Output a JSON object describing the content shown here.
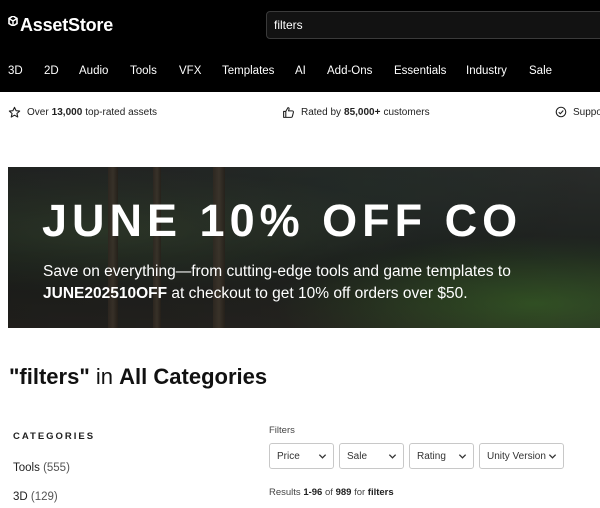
{
  "header": {
    "logo_text": "AssetStore",
    "search_value": "filters",
    "nav": [
      "3D",
      "2D",
      "Audio",
      "Tools",
      "VFX",
      "Templates",
      "AI",
      "Add-Ons",
      "Essentials",
      "Industry",
      "Sale"
    ]
  },
  "value_bar": {
    "assets_prefix": "Over",
    "assets_count": "13,000",
    "assets_suffix": "top-rated assets",
    "rated_prefix": "Rated by",
    "rated_count": "85,000+",
    "rated_suffix": "customers",
    "support_text": "Suppo"
  },
  "banner": {
    "title": "JUNE 10% OFF CO",
    "line1": "Save on everything—from cutting-edge tools and game templates to",
    "code": "JUNE202510OFF",
    "line2_rest": "at checkout to get 10% off orders over $50."
  },
  "results_heading": {
    "query": "\"filters\"",
    "in_word": "in",
    "scope": "All Categories"
  },
  "categories": {
    "title": "CATEGORIES",
    "items": [
      {
        "label": "Tools",
        "count": "(555)"
      },
      {
        "label": "3D",
        "count": "(129)"
      }
    ]
  },
  "filters": {
    "label": "Filters",
    "dropdowns": [
      "Price",
      "Sale",
      "Rating",
      "Unity Version"
    ]
  },
  "results": {
    "prefix": "Results",
    "range": "1-96",
    "of_word": "of",
    "total": "989",
    "for_word": "for",
    "query": "filters"
  },
  "colors": {
    "header_bg": "#000000",
    "text": "#212121",
    "border": "#c8c8c8"
  }
}
